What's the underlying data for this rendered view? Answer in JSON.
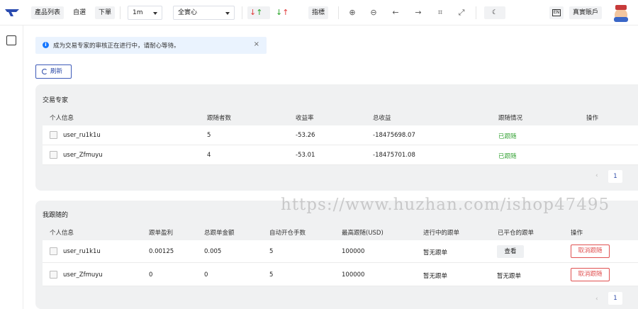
{
  "toolbar": {
    "product_list": "產品列表",
    "watchlist": "自選",
    "order": "下單",
    "interval": "1m",
    "market": "全實心",
    "indicators": "指標",
    "account": "真實賬戶"
  },
  "alert": {
    "message": "成为交易专家的审核正在进行中，请耐心等待。",
    "close": "×"
  },
  "refresh_label": "刷新",
  "experts": {
    "title": "交易专家",
    "columns": [
      "个人信息",
      "跟随者数",
      "收益率",
      "总收益",
      "跟随情况",
      "操作"
    ],
    "rows": [
      {
        "user": "user_ru1k1u",
        "followers": "5",
        "return_rate": "-53.26",
        "total_profit": "-18475698.07",
        "status": "已跟随"
      },
      {
        "user": "user_Zfmuyu",
        "followers": "4",
        "return_rate": "-53.01",
        "total_profit": "-18475701.08",
        "status": "已跟随"
      }
    ],
    "page": "1"
  },
  "following": {
    "title": "我跟随的",
    "columns": [
      "个人信息",
      "跟单盈利",
      "总跟单金额",
      "自动开仓手数",
      "最高跟随(USD)",
      "进行中的跟单",
      "已平仓的跟单",
      "操作"
    ],
    "rows": [
      {
        "user": "user_ru1k1u",
        "profit": "0.00125",
        "total_amount": "0.005",
        "auto_lots": "5",
        "max_follow": "100000",
        "in_progress": "暂无跟单",
        "closed": "查看",
        "action": "取消跟随"
      },
      {
        "user": "user_Zfmuyu",
        "profit": "0",
        "total_amount": "0",
        "auto_lots": "5",
        "max_follow": "100000",
        "in_progress": "暂无跟单",
        "closed": "暂无跟单",
        "action": "取消跟随"
      }
    ],
    "page": "1"
  },
  "watermark": "https://www.huzhan.com/ishop47495",
  "colors": {
    "accent": "#2c4aa8",
    "profit_green": "#3aa53a",
    "danger_red": "#e05050",
    "panel_bg": "#f0f1f2"
  }
}
